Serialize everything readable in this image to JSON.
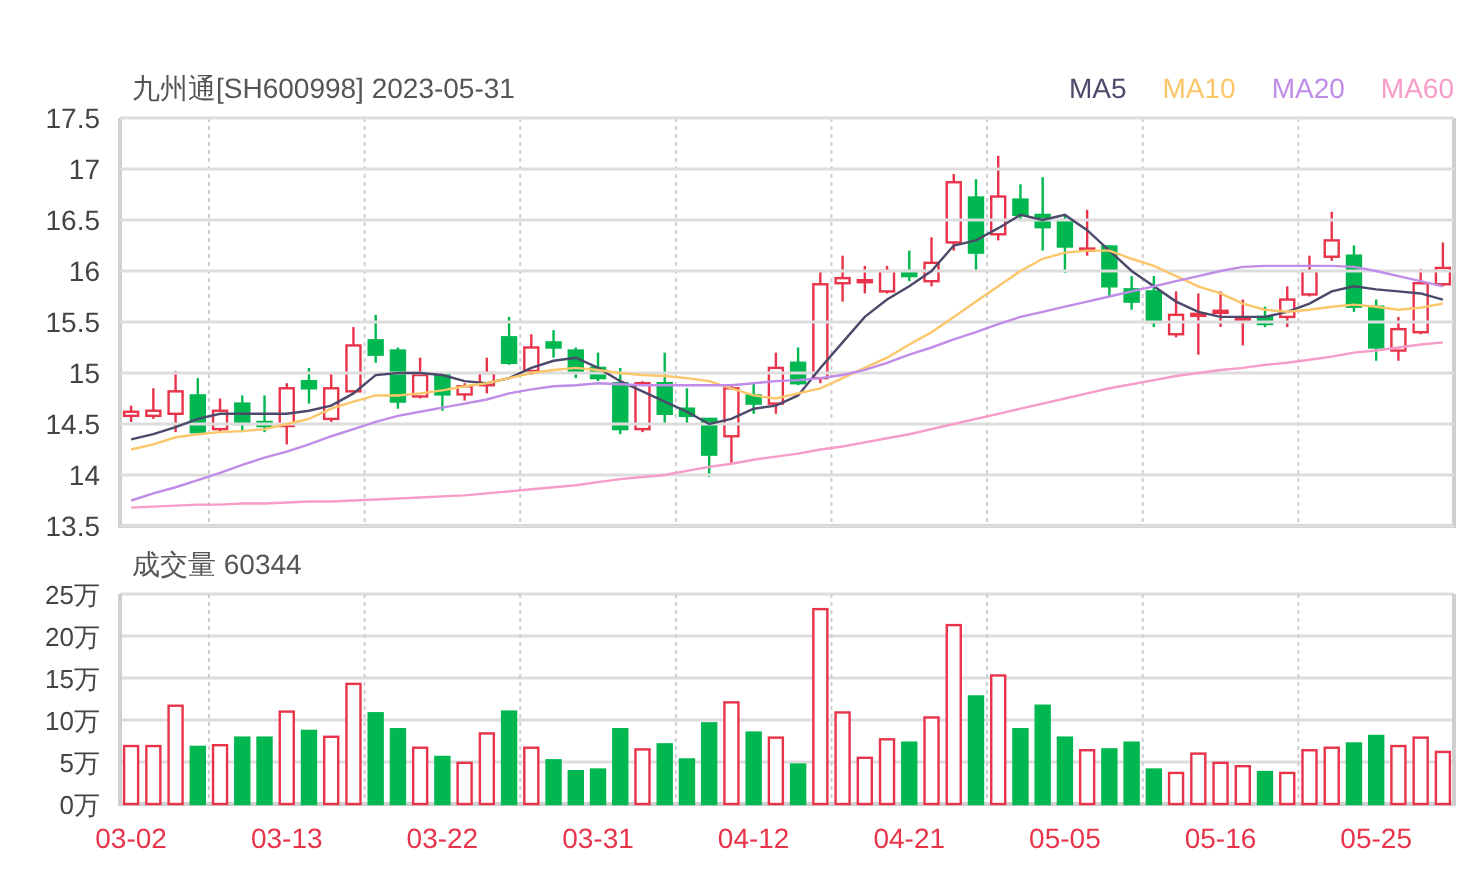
{
  "title": "九州通[SH600998] 2023-05-31",
  "price_chart": {
    "chart_data": {
      "type": "candlestick",
      "grid": true,
      "ylim": [
        13.5,
        17.5
      ],
      "yticks": [
        13.5,
        14,
        14.5,
        15,
        15.5,
        16,
        16.5,
        17,
        17.5
      ],
      "categories": [
        null,
        null,
        null,
        null,
        null,
        null,
        null,
        null,
        null,
        null,
        null,
        null,
        null,
        null,
        null,
        null,
        null,
        null,
        null,
        null,
        null,
        null,
        null,
        null,
        null,
        null,
        null,
        null,
        null,
        null,
        null,
        null,
        null,
        null,
        null,
        null,
        null,
        null,
        null,
        null,
        null,
        null,
        null,
        null,
        null,
        null,
        null,
        null,
        null,
        null,
        null,
        null,
        null,
        null,
        null,
        null,
        null,
        null,
        null,
        null
      ],
      "ohlc": [
        [
          14.58,
          14.68,
          14.52,
          14.62
        ],
        [
          14.58,
          14.85,
          14.55,
          14.63
        ],
        [
          14.6,
          15.02,
          14.42,
          14.82
        ],
        [
          14.78,
          14.95,
          14.4,
          14.42
        ],
        [
          14.45,
          14.75,
          14.42,
          14.63
        ],
        [
          14.7,
          14.78,
          14.42,
          14.5
        ],
        [
          14.52,
          14.78,
          14.42,
          14.48
        ],
        [
          14.48,
          14.9,
          14.3,
          14.85
        ],
        [
          14.92,
          15.05,
          14.7,
          14.85
        ],
        [
          14.55,
          15.0,
          14.52,
          14.85
        ],
        [
          14.82,
          15.45,
          14.8,
          15.27
        ],
        [
          15.32,
          15.57,
          15.1,
          15.18
        ],
        [
          15.22,
          15.25,
          14.65,
          14.72
        ],
        [
          14.77,
          15.15,
          14.75,
          14.98
        ],
        [
          14.98,
          15.0,
          14.63,
          14.79
        ],
        [
          14.79,
          14.9,
          14.73,
          14.87
        ],
        [
          14.88,
          15.15,
          14.8,
          15.0
        ],
        [
          15.35,
          15.55,
          15.08,
          15.1
        ],
        [
          15.02,
          15.38,
          14.98,
          15.25
        ],
        [
          15.3,
          15.42,
          15.15,
          15.25
        ],
        [
          15.22,
          15.25,
          14.95,
          15.02
        ],
        [
          15.05,
          15.2,
          14.92,
          14.95
        ],
        [
          14.9,
          15.05,
          14.4,
          14.45
        ],
        [
          14.45,
          14.92,
          14.42,
          14.9
        ],
        [
          14.9,
          15.2,
          14.5,
          14.6
        ],
        [
          14.65,
          14.85,
          14.5,
          14.58
        ],
        [
          14.55,
          14.55,
          13.98,
          14.2
        ],
        [
          14.38,
          14.88,
          14.12,
          14.85
        ],
        [
          14.78,
          14.9,
          14.6,
          14.7
        ],
        [
          14.7,
          15.2,
          14.6,
          15.05
        ],
        [
          15.1,
          15.25,
          14.88,
          14.9
        ],
        [
          14.95,
          16.0,
          14.9,
          15.87
        ],
        [
          15.88,
          16.15,
          15.7,
          15.93
        ],
        [
          15.89,
          16.05,
          15.78,
          15.91
        ],
        [
          15.8,
          16.05,
          15.78,
          16.0
        ],
        [
          16.0,
          16.2,
          15.9,
          15.95
        ],
        [
          15.9,
          16.33,
          15.85,
          16.08
        ],
        [
          16.28,
          16.95,
          16.2,
          16.87
        ],
        [
          16.72,
          16.9,
          16.0,
          16.18
        ],
        [
          16.36,
          17.13,
          16.3,
          16.73
        ],
        [
          16.7,
          16.85,
          16.5,
          16.55
        ],
        [
          16.55,
          16.92,
          16.2,
          16.43
        ],
        [
          16.5,
          16.55,
          15.98,
          16.24
        ],
        [
          16.2,
          16.6,
          16.15,
          16.22
        ],
        [
          16.24,
          16.25,
          15.75,
          15.85
        ],
        [
          15.82,
          15.95,
          15.62,
          15.7
        ],
        [
          15.8,
          15.95,
          15.45,
          15.5
        ],
        [
          15.38,
          15.8,
          15.35,
          15.57
        ],
        [
          15.56,
          15.78,
          15.18,
          15.58
        ],
        [
          15.59,
          15.8,
          15.45,
          15.61
        ],
        [
          15.51,
          15.72,
          15.27,
          15.53
        ],
        [
          15.55,
          15.65,
          15.45,
          15.48
        ],
        [
          15.55,
          15.85,
          15.45,
          15.72
        ],
        [
          15.77,
          16.15,
          15.75,
          16.0
        ],
        [
          16.14,
          16.58,
          16.1,
          16.3
        ],
        [
          16.15,
          16.25,
          15.6,
          15.65
        ],
        [
          15.65,
          15.72,
          15.12,
          15.25
        ],
        [
          15.22,
          15.55,
          15.12,
          15.43
        ],
        [
          15.4,
          16.02,
          15.38,
          15.88
        ],
        [
          15.87,
          16.28,
          15.85,
          16.03
        ]
      ]
    },
    "moving_averages": {
      "chart_data": {
        "type": "line",
        "grid": true,
        "ylim": [
          13.5,
          17.5
        ],
        "categories": [
          null,
          null,
          null,
          null,
          null,
          null,
          null,
          null,
          null,
          null,
          null,
          null,
          null,
          null,
          null,
          null,
          null,
          null,
          null,
          null,
          null,
          null,
          null,
          null,
          null,
          null,
          null,
          null,
          null,
          null,
          null,
          null,
          null,
          null,
          null,
          null,
          null,
          null,
          null,
          null,
          null,
          null,
          null,
          null,
          null,
          null,
          null,
          null,
          null,
          null,
          null,
          null,
          null,
          null,
          null,
          null,
          null,
          null,
          null,
          null
        ],
        "series": [
          {
            "name": "MA5",
            "color": "#4b4a6b",
            "values": [
              14.35,
              14.4,
              14.47,
              14.55,
              14.6,
              14.6,
              14.6,
              14.6,
              14.63,
              14.68,
              14.8,
              14.98,
              15.0,
              15.0,
              14.98,
              14.92,
              14.9,
              14.95,
              15.05,
              15.12,
              15.15,
              15.05,
              14.92,
              14.82,
              14.72,
              14.62,
              14.5,
              14.55,
              14.65,
              14.68,
              14.78,
              15.05,
              15.3,
              15.55,
              15.72,
              15.85,
              16.0,
              16.25,
              16.3,
              16.42,
              16.55,
              16.5,
              16.55,
              16.4,
              16.2,
              16.0,
              15.85,
              15.7,
              15.6,
              15.55,
              15.55,
              15.55,
              15.6,
              15.68,
              15.8,
              15.85,
              15.82,
              15.8,
              15.78,
              15.72
            ]
          },
          {
            "name": "MA10",
            "color": "#fcc66a",
            "values": [
              14.25,
              14.3,
              14.37,
              14.4,
              14.42,
              14.43,
              14.45,
              14.5,
              14.55,
              14.65,
              14.72,
              14.78,
              14.78,
              14.8,
              14.83,
              14.87,
              14.9,
              14.95,
              15.0,
              15.03,
              15.05,
              15.03,
              15.0,
              14.98,
              14.97,
              14.95,
              14.92,
              14.85,
              14.78,
              14.75,
              14.8,
              14.85,
              14.95,
              15.05,
              15.15,
              15.28,
              15.4,
              15.55,
              15.7,
              15.85,
              16.0,
              16.12,
              16.18,
              16.2,
              16.2,
              16.12,
              16.05,
              15.95,
              15.85,
              15.78,
              15.68,
              15.62,
              15.6,
              15.62,
              15.65,
              15.67,
              15.65,
              15.62,
              15.64,
              15.68
            ]
          },
          {
            "name": "MA20",
            "color": "#c08ce8",
            "values": [
              13.75,
              13.82,
              13.88,
              13.95,
              14.02,
              14.1,
              14.17,
              14.23,
              14.3,
              14.38,
              14.45,
              14.52,
              14.58,
              14.62,
              14.66,
              14.7,
              14.74,
              14.8,
              14.84,
              14.87,
              14.88,
              14.9,
              14.89,
              14.88,
              14.88,
              14.88,
              14.88,
              14.88,
              14.9,
              14.92,
              14.93,
              14.95,
              14.98,
              15.03,
              15.1,
              15.18,
              15.25,
              15.33,
              15.4,
              15.48,
              15.55,
              15.6,
              15.65,
              15.7,
              15.75,
              15.8,
              15.85,
              15.9,
              15.95,
              16.0,
              16.04,
              16.05,
              16.05,
              16.05,
              16.05,
              16.04,
              16.0,
              15.95,
              15.9,
              15.85
            ]
          },
          {
            "name": "MA60",
            "color": "#f79bc8",
            "values": [
              13.68,
              13.69,
              13.7,
              13.71,
              13.71,
              13.72,
              13.72,
              13.73,
              13.74,
              13.74,
              13.75,
              13.76,
              13.77,
              13.78,
              13.79,
              13.8,
              13.82,
              13.84,
              13.86,
              13.88,
              13.9,
              13.93,
              13.96,
              13.98,
              14.0,
              14.04,
              14.08,
              14.11,
              14.15,
              14.18,
              14.21,
              14.25,
              14.28,
              14.32,
              14.36,
              14.4,
              14.45,
              14.5,
              14.55,
              14.6,
              14.65,
              14.7,
              14.75,
              14.8,
              14.85,
              14.89,
              14.93,
              14.97,
              15.0,
              15.03,
              15.05,
              15.08,
              15.1,
              15.13,
              15.16,
              15.2,
              15.22,
              15.25,
              15.28,
              15.3
            ]
          }
        ]
      }
    }
  },
  "volume_panel": {
    "label": "成交量 60344",
    "chart_data": {
      "type": "bar",
      "grid": true,
      "ylim": [
        0,
        25
      ],
      "yticks": [
        {
          "value": 0,
          "label": "0万"
        },
        {
          "value": 5,
          "label": "5万"
        },
        {
          "value": 10,
          "label": "10万"
        },
        {
          "value": 15,
          "label": "15万"
        },
        {
          "value": 20,
          "label": "20万"
        },
        {
          "value": 25,
          "label": "25万"
        }
      ],
      "categories": [
        "03-02",
        null,
        null,
        null,
        null,
        null,
        null,
        "03-13",
        null,
        null,
        null,
        null,
        null,
        null,
        "03-22",
        null,
        null,
        null,
        null,
        null,
        null,
        "03-31",
        null,
        null,
        null,
        null,
        null,
        null,
        "04-12",
        null,
        null,
        null,
        null,
        null,
        null,
        "04-21",
        null,
        null,
        null,
        null,
        null,
        null,
        "05-05",
        null,
        null,
        null,
        null,
        null,
        null,
        "05-16",
        null,
        null,
        null,
        null,
        null,
        null,
        "05-25",
        null,
        null,
        null
      ],
      "values": [
        6.9,
        6.9,
        11.7,
        6.8,
        7.0,
        7.9,
        7.9,
        11.0,
        8.7,
        8.0,
        14.3,
        10.8,
        8.9,
        6.7,
        5.6,
        4.9,
        8.4,
        11.0,
        6.7,
        5.2,
        3.9,
        4.1,
        8.9,
        6.5,
        7.1,
        5.3,
        9.6,
        12.1,
        8.5,
        7.9,
        4.7,
        23.2,
        10.9,
        5.5,
        7.7,
        7.3,
        10.3,
        21.3,
        12.8,
        15.3,
        8.9,
        11.7,
        7.9,
        6.4,
        6.5,
        7.3,
        4.1,
        3.7,
        6.0,
        4.9,
        4.5,
        3.8,
        3.7,
        6.4,
        6.7,
        7.2,
        8.1,
        6.9,
        7.9,
        6.2
      ]
    }
  }
}
